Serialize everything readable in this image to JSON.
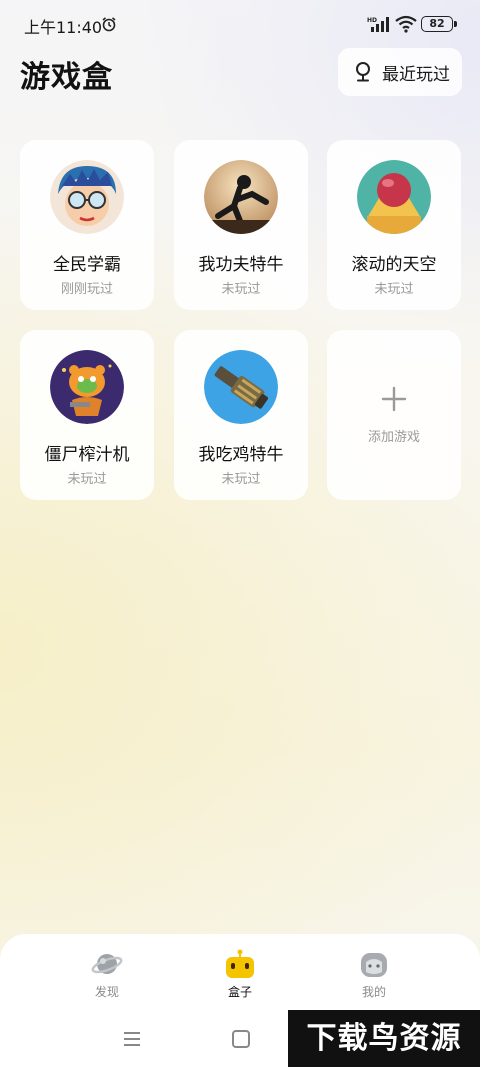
{
  "status_bar": {
    "time": "上午11:40",
    "network_label": "HD",
    "battery": "82"
  },
  "header": {
    "title": "游戏盒",
    "recent_label": "最近玩过"
  },
  "games": [
    {
      "name": "全民学霸",
      "status": "刚刚玩过",
      "icon": "cartoon-boy-glasses"
    },
    {
      "name": "我功夫特牛",
      "status": "未玩过",
      "icon": "kungfu-silhouette"
    },
    {
      "name": "滚动的天空",
      "status": "未玩过",
      "icon": "red-ball"
    },
    {
      "name": "僵尸榨汁机",
      "status": "未玩过",
      "icon": "zombie-tiger"
    },
    {
      "name": "我吃鸡特牛",
      "status": "未玩过",
      "icon": "gatling-gun"
    }
  ],
  "add_card": {
    "label": "添加游戏",
    "icon": "plus-icon"
  },
  "bottom_nav": {
    "items": [
      {
        "label": "发现",
        "icon": "planet-icon",
        "active": false
      },
      {
        "label": "盒子",
        "icon": "robot-box-icon",
        "active": true
      },
      {
        "label": "我的",
        "icon": "face-icon",
        "active": false
      }
    ]
  },
  "watermark": "下载鸟资源",
  "colors": {
    "accent": "#f5c400",
    "text": "#111111",
    "muted": "#9a9a9a"
  }
}
